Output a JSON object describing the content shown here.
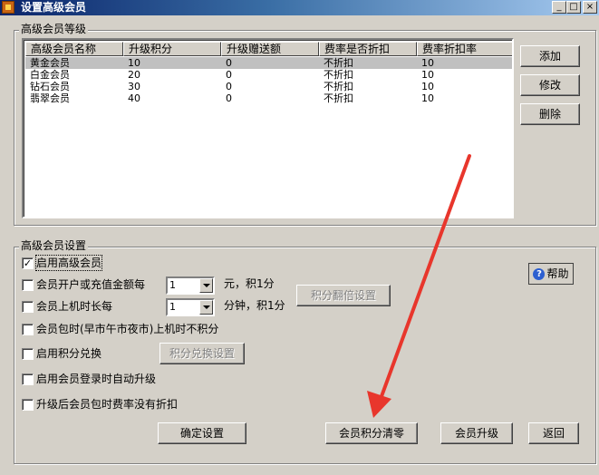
{
  "window": {
    "title": "设置高级会员",
    "caption_buttons": [
      "_",
      "□",
      "×"
    ]
  },
  "levels_group": {
    "title": "高级会员等级",
    "columns": [
      "高级会员名称",
      "升级积分",
      "升级赠送额",
      "费率是否折扣",
      "费率折扣率"
    ],
    "rows": [
      [
        "黄金会员",
        "10",
        "0",
        "不折扣",
        "10"
      ],
      [
        "白金会员",
        "20",
        "0",
        "不折扣",
        "10"
      ],
      [
        "钻石会员",
        "30",
        "0",
        "不折扣",
        "10"
      ],
      [
        "翡翠会员",
        "40",
        "0",
        "不折扣",
        "10"
      ]
    ],
    "add_label": "添加",
    "edit_label": "修改",
    "delete_label": "删除"
  },
  "settings_group": {
    "title": "高级会员设置",
    "help_label": "帮助",
    "enable_vip": {
      "label": "启用高级会员",
      "checked": true
    },
    "recharge": {
      "label": "会员开户或充值金额每",
      "checked": false,
      "value": "1",
      "suffix": "元，积1分"
    },
    "online": {
      "label": "会员上机时长每",
      "checked": false,
      "value": "1",
      "suffix": "分钟，积1分"
    },
    "double_points_label": "积分翻倍设置",
    "package_no_points": {
      "label": "会员包时(早市午市夜市)上机时不积分",
      "checked": false
    },
    "points_exchange": {
      "label": "启用积分兑换",
      "checked": false
    },
    "exchange_settings_label": "积分兑换设置",
    "auto_upgrade": {
      "label": "启用会员登录时自动升级",
      "checked": false
    },
    "no_discount_after_upgrade": {
      "label": "升级后会员包时费率没有折扣",
      "checked": false
    }
  },
  "footer": {
    "confirm_label": "确定设置",
    "clear_points_label": "会员积分清零",
    "upgrade_label": "会员升级",
    "back_label": "返回"
  },
  "annotation": {
    "color": "#e8362c"
  }
}
